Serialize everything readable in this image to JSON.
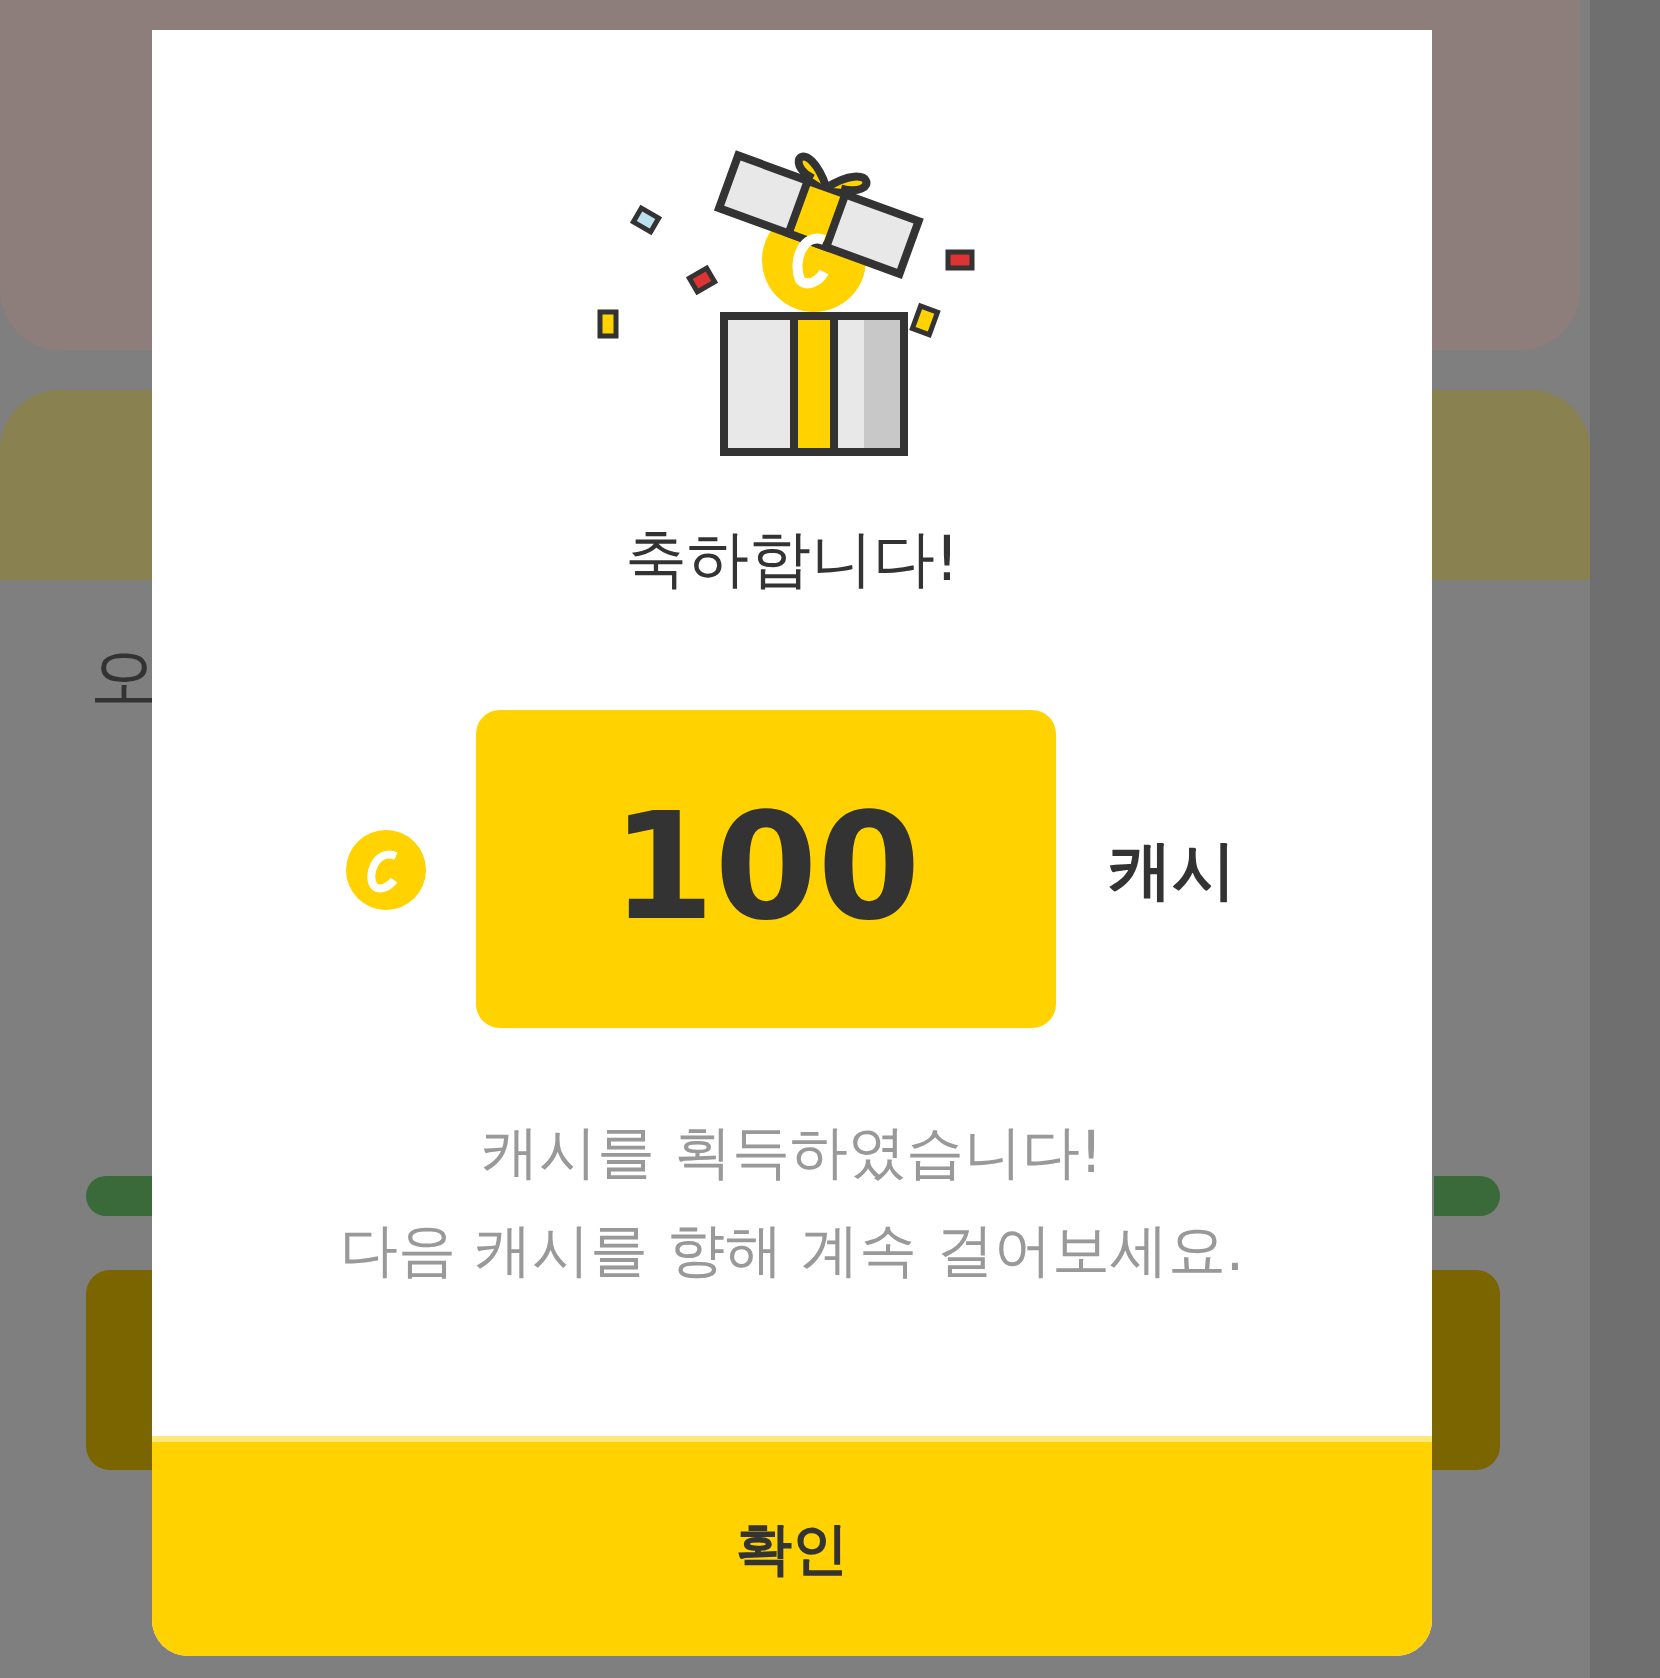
{
  "background": {
    "partial_label": "오"
  },
  "dialog": {
    "title": "축하합니다!",
    "amount": "100",
    "unit": "캐시",
    "message": "캐시를 획득하였습니다!\n다음 캐시를 향해 계속 걸어보세요.",
    "confirm_button": "확인"
  }
}
